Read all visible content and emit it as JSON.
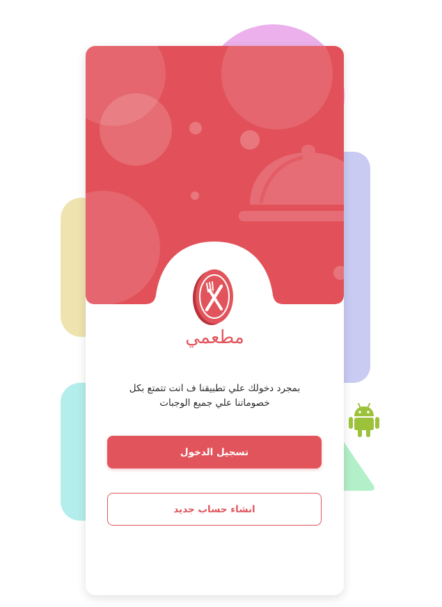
{
  "app": {
    "brand_name": "مطعمي",
    "tagline_line1": "بمجرد دخولك علي تطبيقنا ف انت تتمتع بكل",
    "tagline_line2": "خصوماتنا علي جميع الوجبات"
  },
  "actions": {
    "login_label": "تسجيل الدخول",
    "signup_label": "انشاء حساب جديد"
  },
  "icons": {
    "logo": "fork-knife-icon",
    "hero": "food-cloche-icon",
    "platform": "android-icon"
  },
  "colors": {
    "primary": "#e2545c",
    "hero_background": "#e2515a",
    "pink_shape": "#ecb1ec",
    "yellow_shape": "#efe4b0",
    "purple_shape": "#c9cbf3",
    "cyan_shape": "#b3eeec",
    "green_shape": "#b3f0c9",
    "android_green": "#9cc13a"
  }
}
